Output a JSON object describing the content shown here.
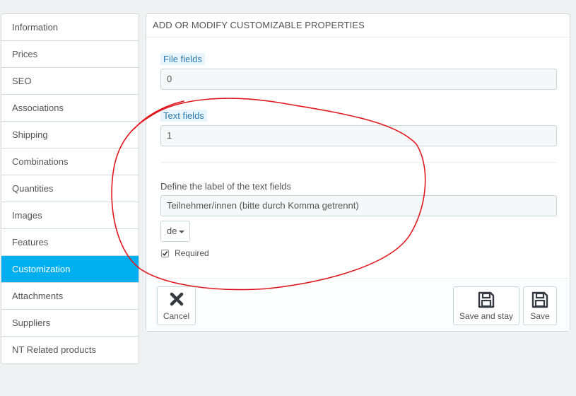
{
  "sidebar": {
    "items": [
      {
        "label": "Information"
      },
      {
        "label": "Prices"
      },
      {
        "label": "SEO"
      },
      {
        "label": "Associations"
      },
      {
        "label": "Shipping"
      },
      {
        "label": "Combinations"
      },
      {
        "label": "Quantities"
      },
      {
        "label": "Images"
      },
      {
        "label": "Features"
      },
      {
        "label": "Customization"
      },
      {
        "label": "Attachments"
      },
      {
        "label": "Suppliers"
      },
      {
        "label": "NT Related products"
      }
    ],
    "active": "Customization"
  },
  "panel": {
    "title": "ADD OR MODIFY CUSTOMIZABLE PROPERTIES",
    "file_fields_label": "File fields",
    "file_fields_value": "0",
    "text_fields_label": "Text fields",
    "text_fields_value": "1",
    "define_label": "Define the label of the text fields",
    "text_field_label_value": "Teilnehmer/innen (bitte durch Komma getrennt)",
    "language": "de",
    "required_label": "Required",
    "required_checked": true
  },
  "footer": {
    "cancel_label": "Cancel",
    "save_and_stay_label": "Save and stay",
    "save_label": "Save"
  },
  "colors": {
    "active_tab": "#00aff0",
    "annotation": "#e0191f"
  }
}
